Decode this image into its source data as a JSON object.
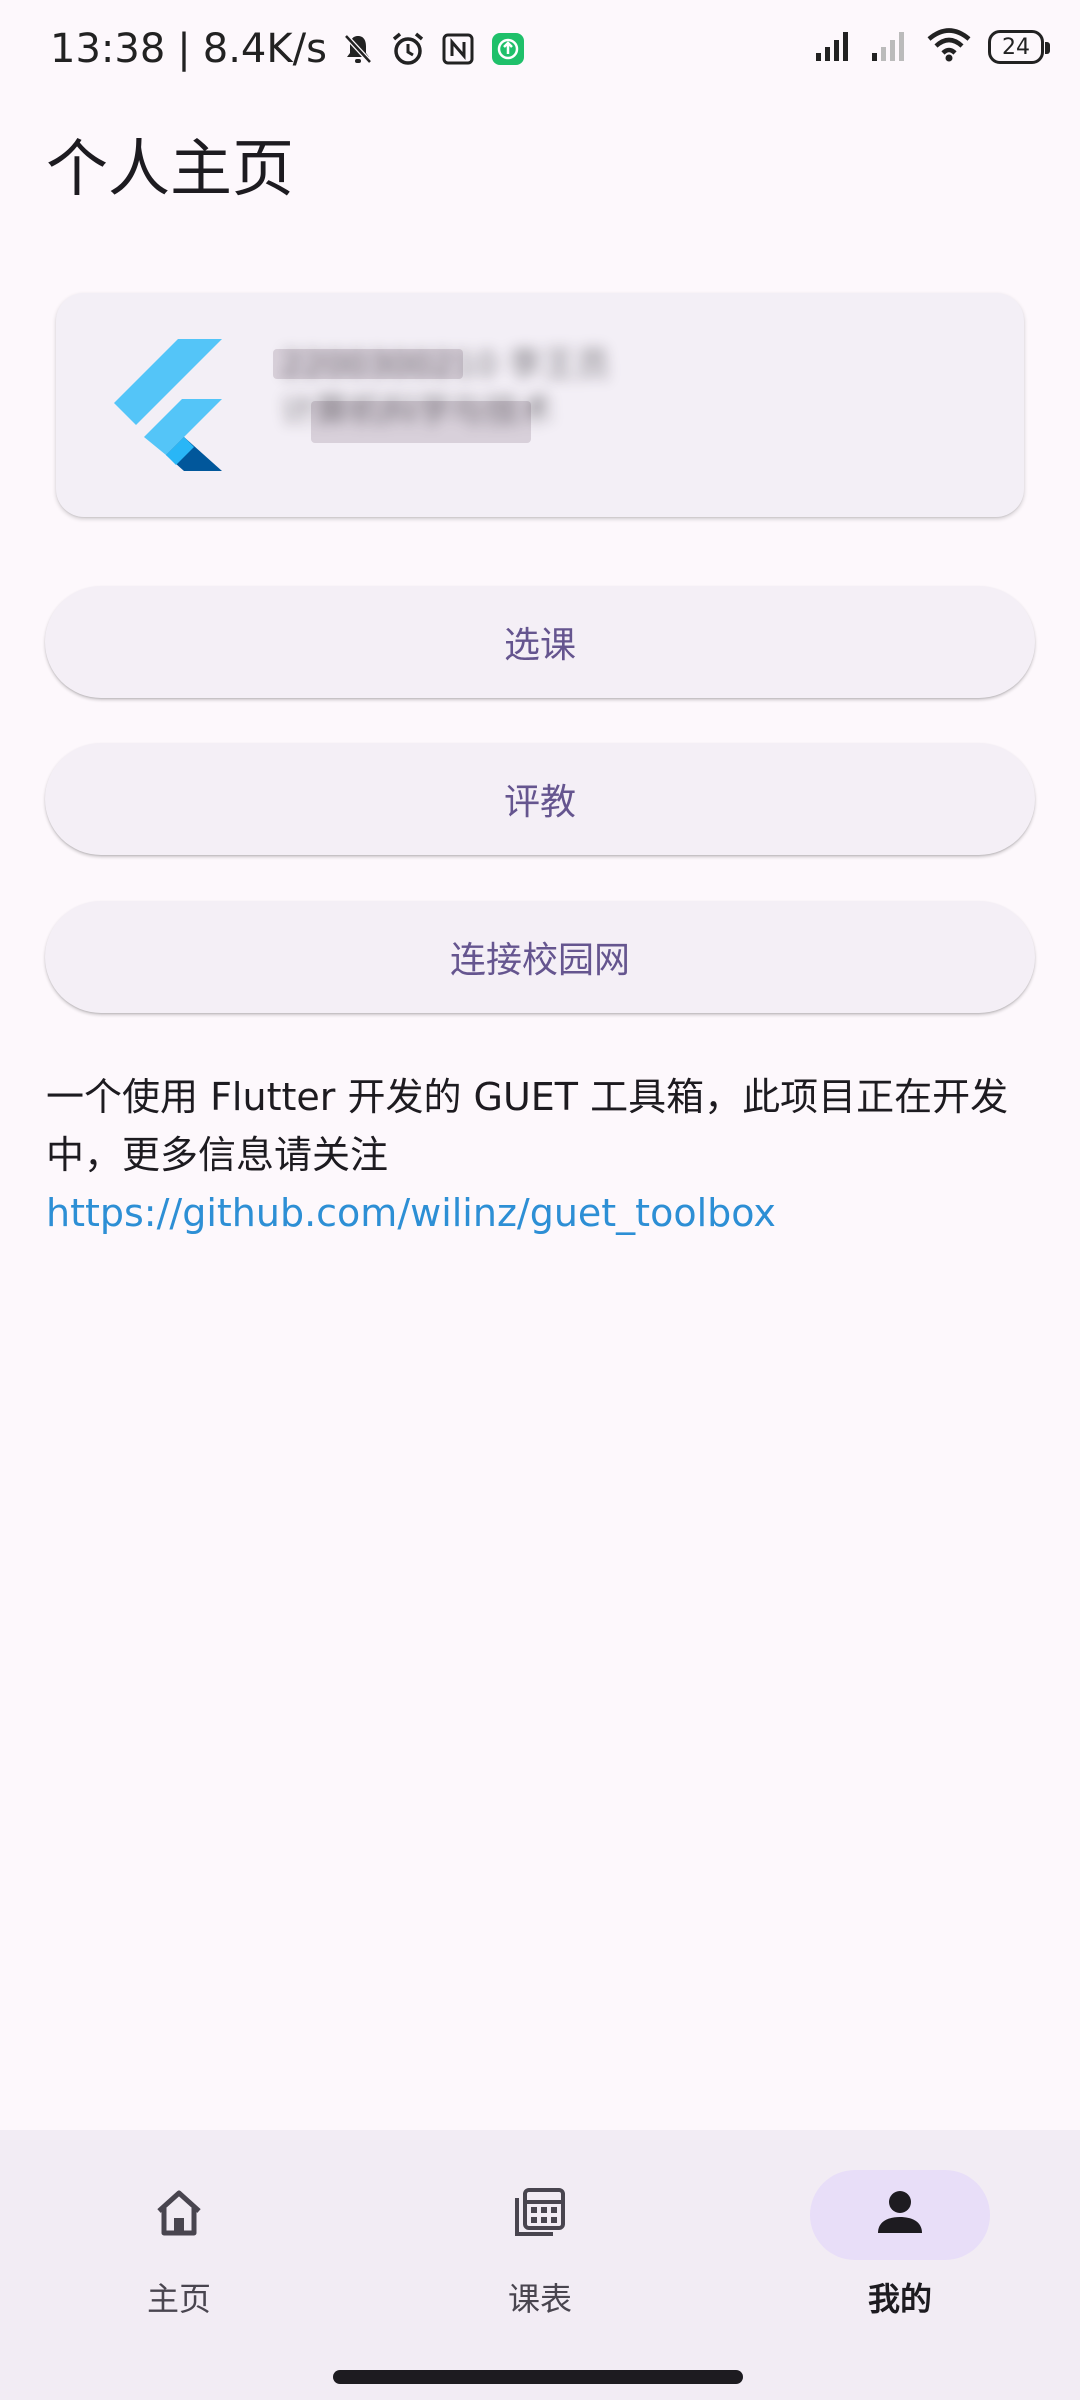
{
  "status_bar": {
    "time": "13:38",
    "separator": "|",
    "net_speed": "8.4K/s",
    "battery_level": "24",
    "icons": [
      "mute-bell-icon",
      "alarm-icon",
      "nfc-icon",
      "app-update-icon",
      "signal-icon",
      "signal-weak-icon",
      "wifi-icon",
      "battery-icon"
    ]
  },
  "header": {
    "title": "个人主页"
  },
  "profile": {
    "line1": "2200300210 李王员",
    "line2": "计算机科学与技术"
  },
  "actions": {
    "select_course": "选课",
    "evaluate": "评教",
    "campus_network": "连接校园网"
  },
  "description": {
    "text": "一个使用 Flutter 开发的 GUET 工具箱，此项目正在开发中，更多信息请关注 ",
    "link": "https://github.com/wilinz/guet_toolbox"
  },
  "bottom_nav": {
    "home": "主页",
    "schedule": "课表",
    "mine": "我的",
    "active": "mine"
  },
  "colors": {
    "accent": "#65558f",
    "link": "#2d8fd5",
    "active_indicator": "#e8def8",
    "background": "#fdf8fc"
  }
}
